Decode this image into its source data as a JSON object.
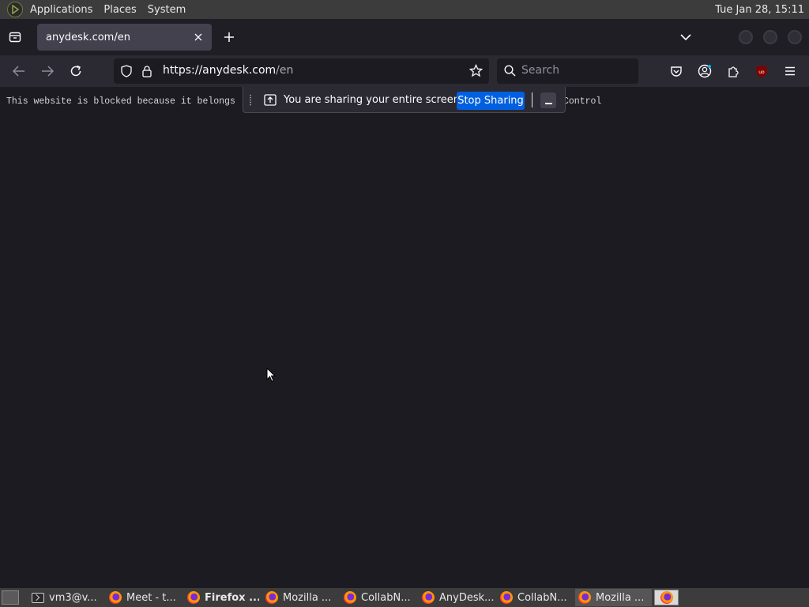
{
  "system_panel": {
    "menus": [
      "Applications",
      "Places",
      "System"
    ],
    "clock": "Tue Jan 28, 15:11"
  },
  "browser": {
    "tab": {
      "title": "anydesk.com/en"
    },
    "url": {
      "host": "https://anydesk.com",
      "path": "/en"
    },
    "search_placeholder": "Search",
    "colors": {
      "accent": "#0060df",
      "background": "#1c1b22",
      "toolbar": "#2b2a33"
    }
  },
  "page": {
    "blocked_left": "This website is blocked because it belongs",
    "blocked_right": "Control"
  },
  "share_notification": {
    "message": "You are sharing your entire screen.",
    "stop_label": "Stop Sharing"
  },
  "taskbar": {
    "tasks": [
      {
        "label": "vm3@v...",
        "icon": "terminal-icon"
      },
      {
        "label": "Meet - t...",
        "icon": "firefox-icon"
      },
      {
        "label": "Firefox ...",
        "icon": "firefox-icon"
      },
      {
        "label": "Mozilla ...",
        "icon": "firefox-icon"
      },
      {
        "label": "CollabN...",
        "icon": "firefox-icon"
      },
      {
        "label": "AnyDesk...",
        "icon": "firefox-icon"
      },
      {
        "label": "CollabN...",
        "icon": "firefox-icon"
      },
      {
        "label": "Mozilla ...",
        "icon": "firefox-icon"
      }
    ]
  }
}
